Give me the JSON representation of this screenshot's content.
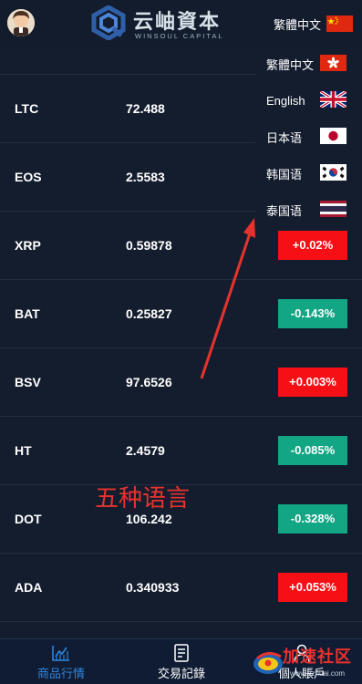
{
  "header": {
    "logo_cn": "云岫資本",
    "logo_en": "WINSOUL CAPITAL",
    "current_language": "繁體中文"
  },
  "language_menu": [
    {
      "label": "繁體中文",
      "flag": "hong-kong-flag"
    },
    {
      "label": "English",
      "flag": "uk-flag"
    },
    {
      "label": "日本语",
      "flag": "japan-flag"
    },
    {
      "label": "韩国语",
      "flag": "korea-flag"
    },
    {
      "label": "泰国语",
      "flag": "thailand-flag"
    }
  ],
  "coins": [
    {
      "symbol": "",
      "price": "",
      "change": ""
    },
    {
      "symbol": "LTC",
      "price": "72.488",
      "change": ""
    },
    {
      "symbol": "EOS",
      "price": "2.5583",
      "change": ""
    },
    {
      "symbol": "XRP",
      "price": "0.59878",
      "change": "+0.02%",
      "direction": "up"
    },
    {
      "symbol": "BAT",
      "price": "0.25827",
      "change": "-0.143%",
      "direction": "down"
    },
    {
      "symbol": "BSV",
      "price": "97.6526",
      "change": "+0.003%",
      "direction": "up"
    },
    {
      "symbol": "HT",
      "price": "2.4579",
      "change": "-0.085%",
      "direction": "down"
    },
    {
      "symbol": "DOT",
      "price": "106.242",
      "change": "-0.328%",
      "direction": "down"
    },
    {
      "symbol": "ADA",
      "price": "0.340933",
      "change": "+0.053%",
      "direction": "up"
    }
  ],
  "annotation": {
    "text": "五种语言"
  },
  "bottom_nav": [
    {
      "label": "商品行情",
      "icon": "chart-icon",
      "active": true
    },
    {
      "label": "交易記錄",
      "icon": "document-icon",
      "active": false
    },
    {
      "label": "個人賬戶",
      "icon": "user-icon",
      "active": false
    }
  ],
  "watermark": {
    "text": "加速社区",
    "url": "www.pzhuai.com"
  },
  "colors": {
    "background": "#141d2e",
    "up": "#f60f14",
    "down": "#12a684",
    "active_nav": "#2e86de",
    "annotation": "#e8322e"
  }
}
